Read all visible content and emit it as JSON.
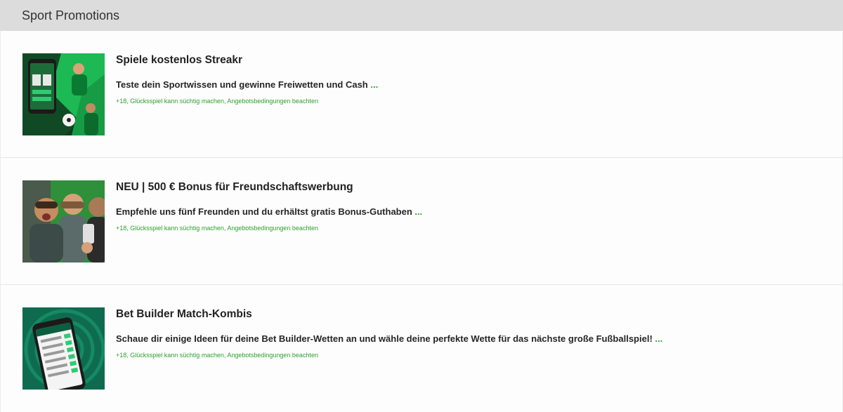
{
  "header": {
    "title": "Sport Promotions"
  },
  "promotions": [
    {
      "title": "Spiele kostenlos Streakr",
      "description": "Teste dein Sportwissen und gewinne Freiwetten und Cash",
      "more": "...",
      "disclaimer": "+18, Glücksspiel kann süchtig machen, Angebotsbedingungen beachten",
      "image": "streakr-app-promo-image"
    },
    {
      "title": "NEU | 500 € Bonus für Freundschaftswerbung",
      "description": "Empfehle uns fünf Freunden und du erhältst gratis Bonus-Guthaben",
      "more": "...",
      "disclaimer": "+18, Glücksspiel kann süchtig machen, Angebotsbedingungen beachten",
      "image": "friends-selfie-promo-image"
    },
    {
      "title": "Bet Builder Match-Kombis",
      "description": "Schaue dir einige Ideen für deine Bet Builder-Wetten an und wähle deine perfekte Wette für das nächste große Fußballspiel!",
      "more": "...",
      "disclaimer": "+18, Glücksspiel kann süchtig machen, Angebotsbedingungen beachten",
      "image": "bet-builder-phone-promo-image"
    }
  ],
  "colors": {
    "accent_green": "#2ea12e",
    "header_bg": "#dcdcdc"
  }
}
